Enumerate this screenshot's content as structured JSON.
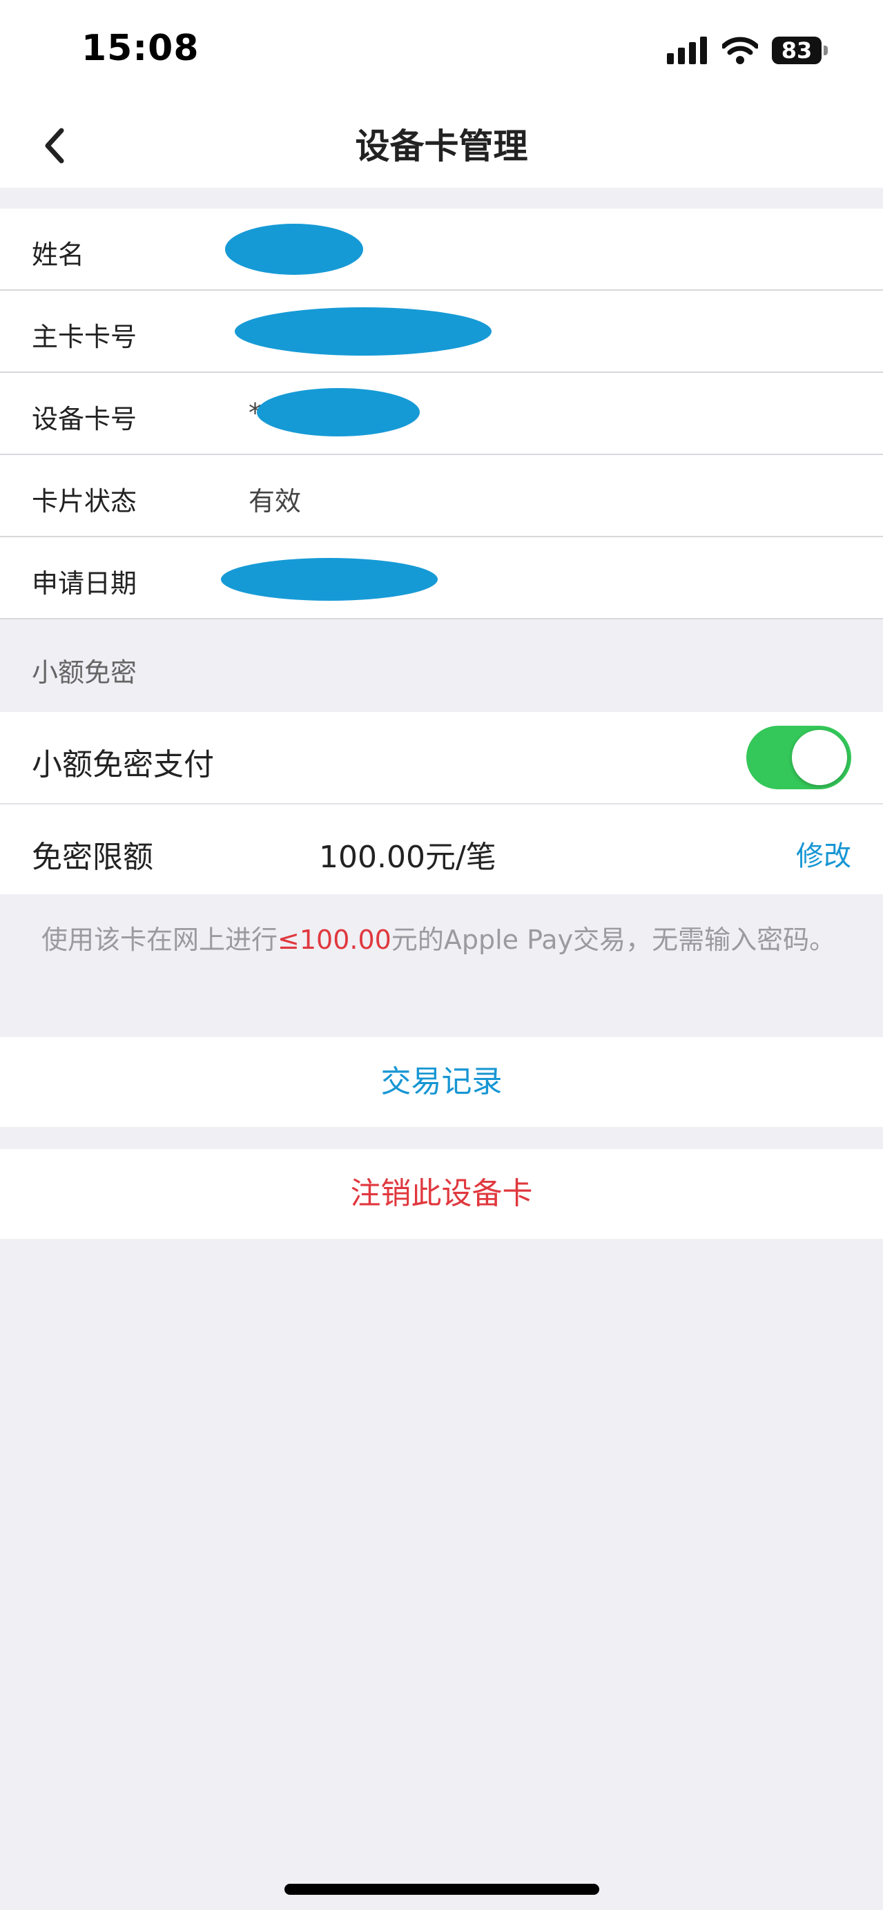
{
  "status_bar": {
    "time": "15:08",
    "battery": "83",
    "icons": [
      "cellular-signal-icon",
      "wifi-icon",
      "battery-icon"
    ]
  },
  "nav": {
    "title": "设备卡管理",
    "back_icon": "chevron-left-icon"
  },
  "info": {
    "name_label": "姓名",
    "main_card_label": "主卡卡号",
    "device_card_label": "设备卡号",
    "device_card_prefix": "*",
    "status_label": "卡片状态",
    "status_value": "有效",
    "apply_date_label": "申请日期"
  },
  "small_amount": {
    "section_title": "小额免密",
    "toggle_label": "小额免密支付",
    "toggle_on": true,
    "limit_label": "免密限额",
    "limit_value": "100.00元/笔",
    "modify_label": "修改",
    "hint_prefix": "使用该卡在网上进行",
    "hint_amount": "≤100.00",
    "hint_suffix": "元的Apple Pay交易，无需输入密码。"
  },
  "actions": {
    "records_label": "交易记录",
    "cancel_label": "注销此设备卡"
  },
  "colors": {
    "accent_blue": "#1796d3",
    "danger_red": "#e0383e",
    "toggle_green": "#34c759",
    "background": "#efeff4"
  }
}
